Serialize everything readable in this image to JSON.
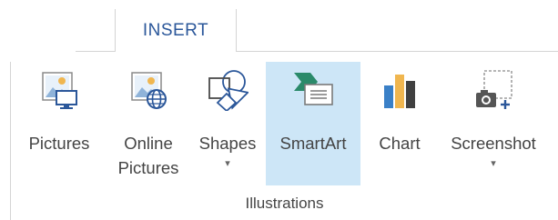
{
  "tabs": {
    "insert": "INSERT"
  },
  "group": {
    "label": "Illustrations"
  },
  "commands": {
    "pictures": {
      "label": "Pictures",
      "icon": "pictures-icon"
    },
    "online_pictures": {
      "label_line1": "Online",
      "label_line2": "Pictures",
      "icon": "online-pictures-icon"
    },
    "shapes": {
      "label": "Shapes",
      "icon": "shapes-icon",
      "dropdown": "▾"
    },
    "smartart": {
      "label": "SmartArt",
      "icon": "smartart-icon",
      "selected": true
    },
    "chart": {
      "label": "Chart",
      "icon": "chart-icon"
    },
    "screenshot": {
      "label": "Screenshot",
      "icon": "screenshot-icon",
      "dropdown": "▾"
    }
  },
  "colors": {
    "accent": "#2b579a",
    "selected_bg": "#cde6f7",
    "chart_blue": "#3a80c7",
    "chart_orange": "#f0b64f",
    "chart_dark": "#404040",
    "smartart_green": "#2a8a6a"
  }
}
